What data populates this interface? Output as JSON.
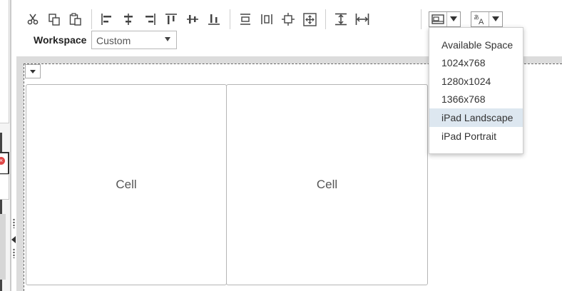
{
  "workspace": {
    "label": "Workspace",
    "selected": "Custom"
  },
  "toolbar": {
    "groups": [
      [
        "cut-icon",
        "copy-icon",
        "paste-icon"
      ],
      [
        "align-left-icon",
        "align-center-icon",
        "align-right-icon",
        "align-top-icon",
        "align-middle-icon",
        "align-bottom-icon"
      ],
      [
        "distribute-vertical-icon",
        "distribute-horizontal-icon",
        "center-icon",
        "fit-icon"
      ],
      [
        "same-height-icon",
        "same-width-icon"
      ]
    ],
    "screen_size_icon": "screen-size-icon",
    "language_icon": "language-icon"
  },
  "screen_size_menu": {
    "items": [
      "Available Space",
      "1024x768",
      "1280x1024",
      "1366x768",
      "iPad Landscape",
      "iPad Portrait"
    ],
    "selected": "iPad Landscape"
  },
  "canvas": {
    "cells": [
      {
        "label": "Cell"
      },
      {
        "label": "Cell"
      }
    ]
  },
  "colors": {
    "selected_item_bg": "#dde7f0",
    "canvas_frame": "#dcdcdc",
    "error_icon": "#e04848"
  }
}
